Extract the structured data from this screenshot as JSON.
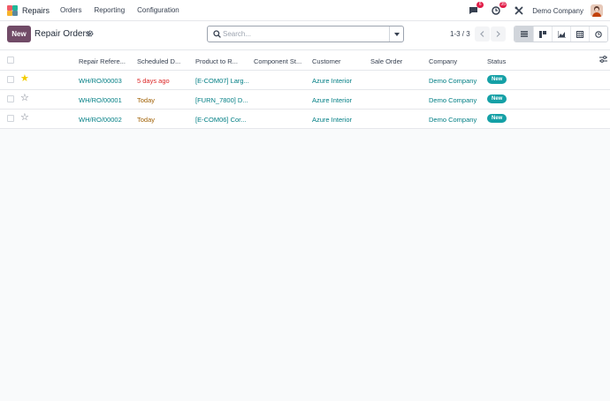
{
  "app": {
    "name": "Repairs",
    "logo_colors": [
      "#f05b67",
      "#21b799",
      "#f7b32b",
      "#5b899e"
    ]
  },
  "menu": [
    "Orders",
    "Reporting",
    "Configuration"
  ],
  "navbar": {
    "messages_count": "6",
    "activities_count": "35",
    "company": "Demo Company"
  },
  "control": {
    "new_label": "New",
    "title": "Repair Orders",
    "search_placeholder": "Search...",
    "pager": "1-3 / 3"
  },
  "table": {
    "columns": [
      "Repair Refere...",
      "Scheduled D...",
      "Product to R...",
      "Component St...",
      "Customer",
      "Sale Order",
      "Company",
      "Status"
    ],
    "rows": [
      {
        "starred": true,
        "reference": "WH/RO/00003",
        "scheduled": "5 days ago",
        "scheduled_state": "late",
        "product": "[E-COM07] Larg...",
        "component_status": "",
        "customer": "Azure Interior",
        "sale_order": "",
        "company": "Demo Company",
        "status": "New"
      },
      {
        "starred": false,
        "reference": "WH/RO/00001",
        "scheduled": "Today",
        "scheduled_state": "today",
        "product": "[FURN_7800] D...",
        "component_status": "",
        "customer": "Azure Interior",
        "sale_order": "",
        "company": "Demo Company",
        "status": "New"
      },
      {
        "starred": false,
        "reference": "WH/RO/00002",
        "scheduled": "Today",
        "scheduled_state": "today",
        "product": "[E-COM06] Cor...",
        "component_status": "",
        "customer": "Azure Interior",
        "sale_order": "",
        "company": "Demo Company",
        "status": "New"
      }
    ]
  }
}
